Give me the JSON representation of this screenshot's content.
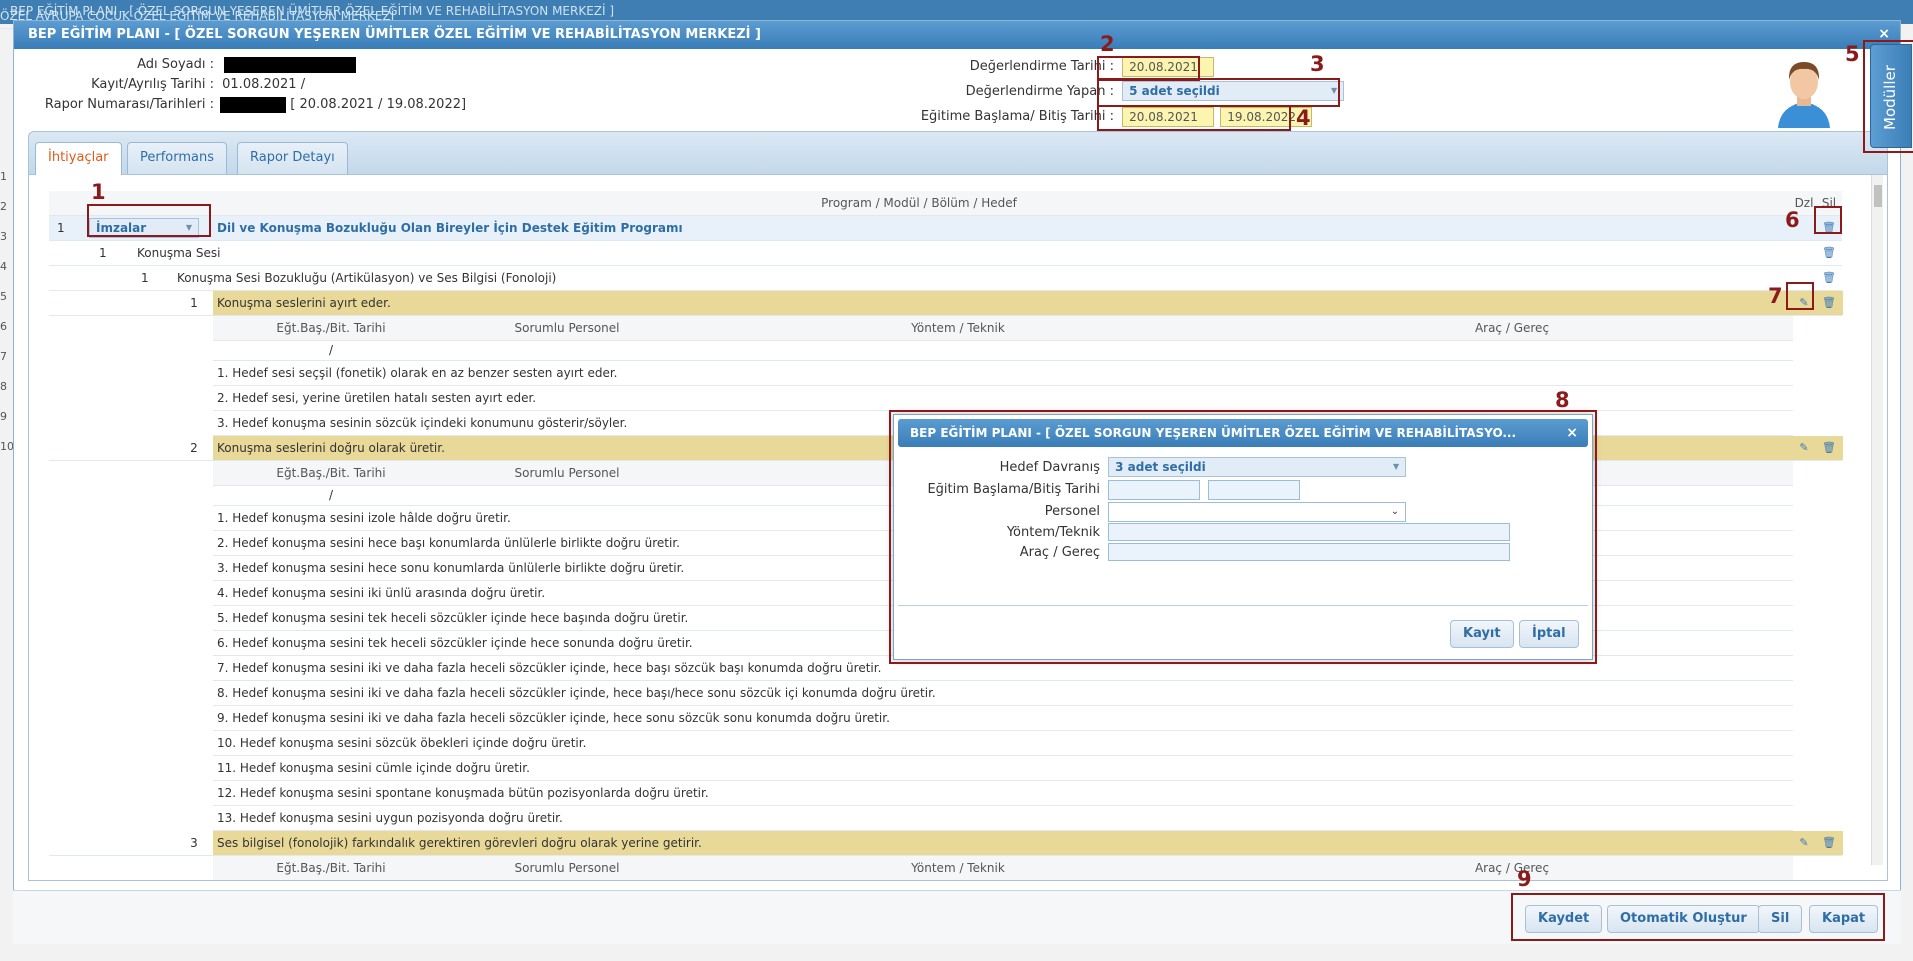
{
  "background": {
    "title_left": "BEP EĞİTİM PLANI - [ ÖZEL SORGUN YEŞEREN ÜMİTLER ÖZEL EĞİTİM VE REHABİLİTASYON MERKEZİ ]",
    "title_right": "ÖZEL AVRUPA ÇOCUK ÖZEL EĞİTİM VE REHABİLİTASYON MERKEZİ",
    "row_numbers": [
      "1",
      "2",
      "3",
      "4",
      "5",
      "6",
      "7",
      "8",
      "9",
      "10"
    ]
  },
  "window": {
    "title": "BEP EĞİTİM PLANI - [ ÖZEL SORGUN YEŞEREN ÜMİTLER ÖZEL EĞİTİM VE REHABİLİTASYON MERKEZİ ]",
    "close": "×"
  },
  "header": {
    "name_label": "Adı Soyadı :",
    "kayit_label": "Kayıt/Ayrılış Tarihi :",
    "kayit_value": "01.08.2021 /",
    "rapor_label": "Rapor Numarası/Tarihleri :",
    "rapor_value": "[ 20.08.2021 / 19.08.2022]",
    "deg_tarih_label": "Değerlendirme Tarihi :",
    "deg_tarih_value": "20.08.2021",
    "deg_yapan_label": "Değerlendirme Yapan :",
    "deg_yapan_value": "5 adet seçildi",
    "egitim_label": "Eğitime Başlama/ Bitiş Tarihi :",
    "egitim_start": "20.08.2021",
    "egitim_end": "19.08.2022"
  },
  "moduller": "Modüller",
  "annotations": [
    "1",
    "2",
    "3",
    "4",
    "5",
    "6",
    "7",
    "8",
    "9"
  ],
  "tabs": [
    {
      "label": "İhtiyaçlar"
    },
    {
      "label": "Performans"
    },
    {
      "label": "Rapor Detayı"
    }
  ],
  "grid": {
    "header": {
      "main": "Program / Modül / Bölüm / Hedef",
      "dzl": "Dzl",
      "sil": "Sil"
    },
    "program_no": "1",
    "imzalar": "İmzalar",
    "program": "Dil ve Konuşma Bozukluğu Olan Bireyler İçin Destek Eğitim Programı",
    "modul_no": "1",
    "modul": "Konuşma Sesi",
    "bolum_no": "1",
    "bolum": "Konuşma Sesi Bozukluğu (Artikülasyon) ve Ses Bilgisi (Fonoloji)",
    "subheader": {
      "tarih": "Eğt.Baş./Bit. Tarihi",
      "personel": "Sorumlu Personel",
      "yontem": "Yöntem / Teknik",
      "arac": "Araç / Gereç"
    },
    "slash": "/",
    "goal1": {
      "no": "1",
      "text": "Konuşma seslerini ayırt eder.",
      "items": [
        "1. Hedef sesi seçşil (fonetik) olarak en az benzer sesten ayırt eder.",
        "2. Hedef sesi, yerine üretilen hatalı sesten ayırt eder.",
        "3. Hedef konuşma sesinin sözcük içindeki konumunu gösterir/söyler."
      ]
    },
    "goal2": {
      "no": "2",
      "text": "Konuşma seslerini doğru olarak üretir.",
      "items": [
        "1. Hedef konuşma sesini izole hâlde doğru üretir.",
        "2. Hedef konuşma sesini hece başı konumlarda ünlülerle birlikte doğru üretir.",
        "3. Hedef konuşma sesini hece sonu konumlarda ünlülerle birlikte doğru üretir.",
        "4. Hedef konuşma sesini iki ünlü arasında doğru üretir.",
        "5. Hedef konuşma sesini tek heceli sözcükler içinde hece başında doğru üretir.",
        "6. Hedef konuşma sesini tek heceli sözcükler içinde hece sonunda doğru üretir.",
        "7. Hedef konuşma sesini iki ve daha fazla heceli sözcükler içinde, hece başı sözcük başı konumda doğru üretir.",
        "8. Hedef konuşma sesini iki ve daha fazla heceli sözcükler içinde, hece başı/hece sonu sözcük içi konumda doğru üretir.",
        "9. Hedef konuşma sesini iki ve daha fazla heceli sözcükler içinde, hece sonu sözcük sonu konumda doğru üretir.",
        "10. Hedef konuşma sesini sözcük öbekleri içinde doğru üretir.",
        "11. Hedef konuşma sesini cümle içinde doğru üretir.",
        "12. Hedef konuşma sesini spontane konuşmada bütün pozisyonlarda doğru üretir.",
        "13. Hedef konuşma sesini uygun pozisyonda doğru üretir."
      ]
    },
    "goal3": {
      "no": "3",
      "text": "Ses bilgisel (fonolojik) farkındalık gerektiren görevleri doğru olarak yerine getirir."
    }
  },
  "dialog": {
    "title": "BEP EĞİTİM PLANI - [ ÖZEL SORGUN YEŞEREN ÜMİTLER ÖZEL EĞİTİM VE REHABİLİTASYO...",
    "close": "×",
    "hedef_label": "Hedef Davranış",
    "hedef_value": "3 adet seçildi",
    "tarih_label": "Eğitim Başlama/Bitiş Tarihi",
    "personel_label": "Personel",
    "yontem_label": "Yöntem/Teknik",
    "arac_label": "Araç / Gereç",
    "save": "Kayıt",
    "cancel": "İptal"
  },
  "footer": {
    "kaydet": "Kaydet",
    "otomatik": "Otomatik Oluştur",
    "sil": "Sil",
    "kapat": "Kapat"
  }
}
